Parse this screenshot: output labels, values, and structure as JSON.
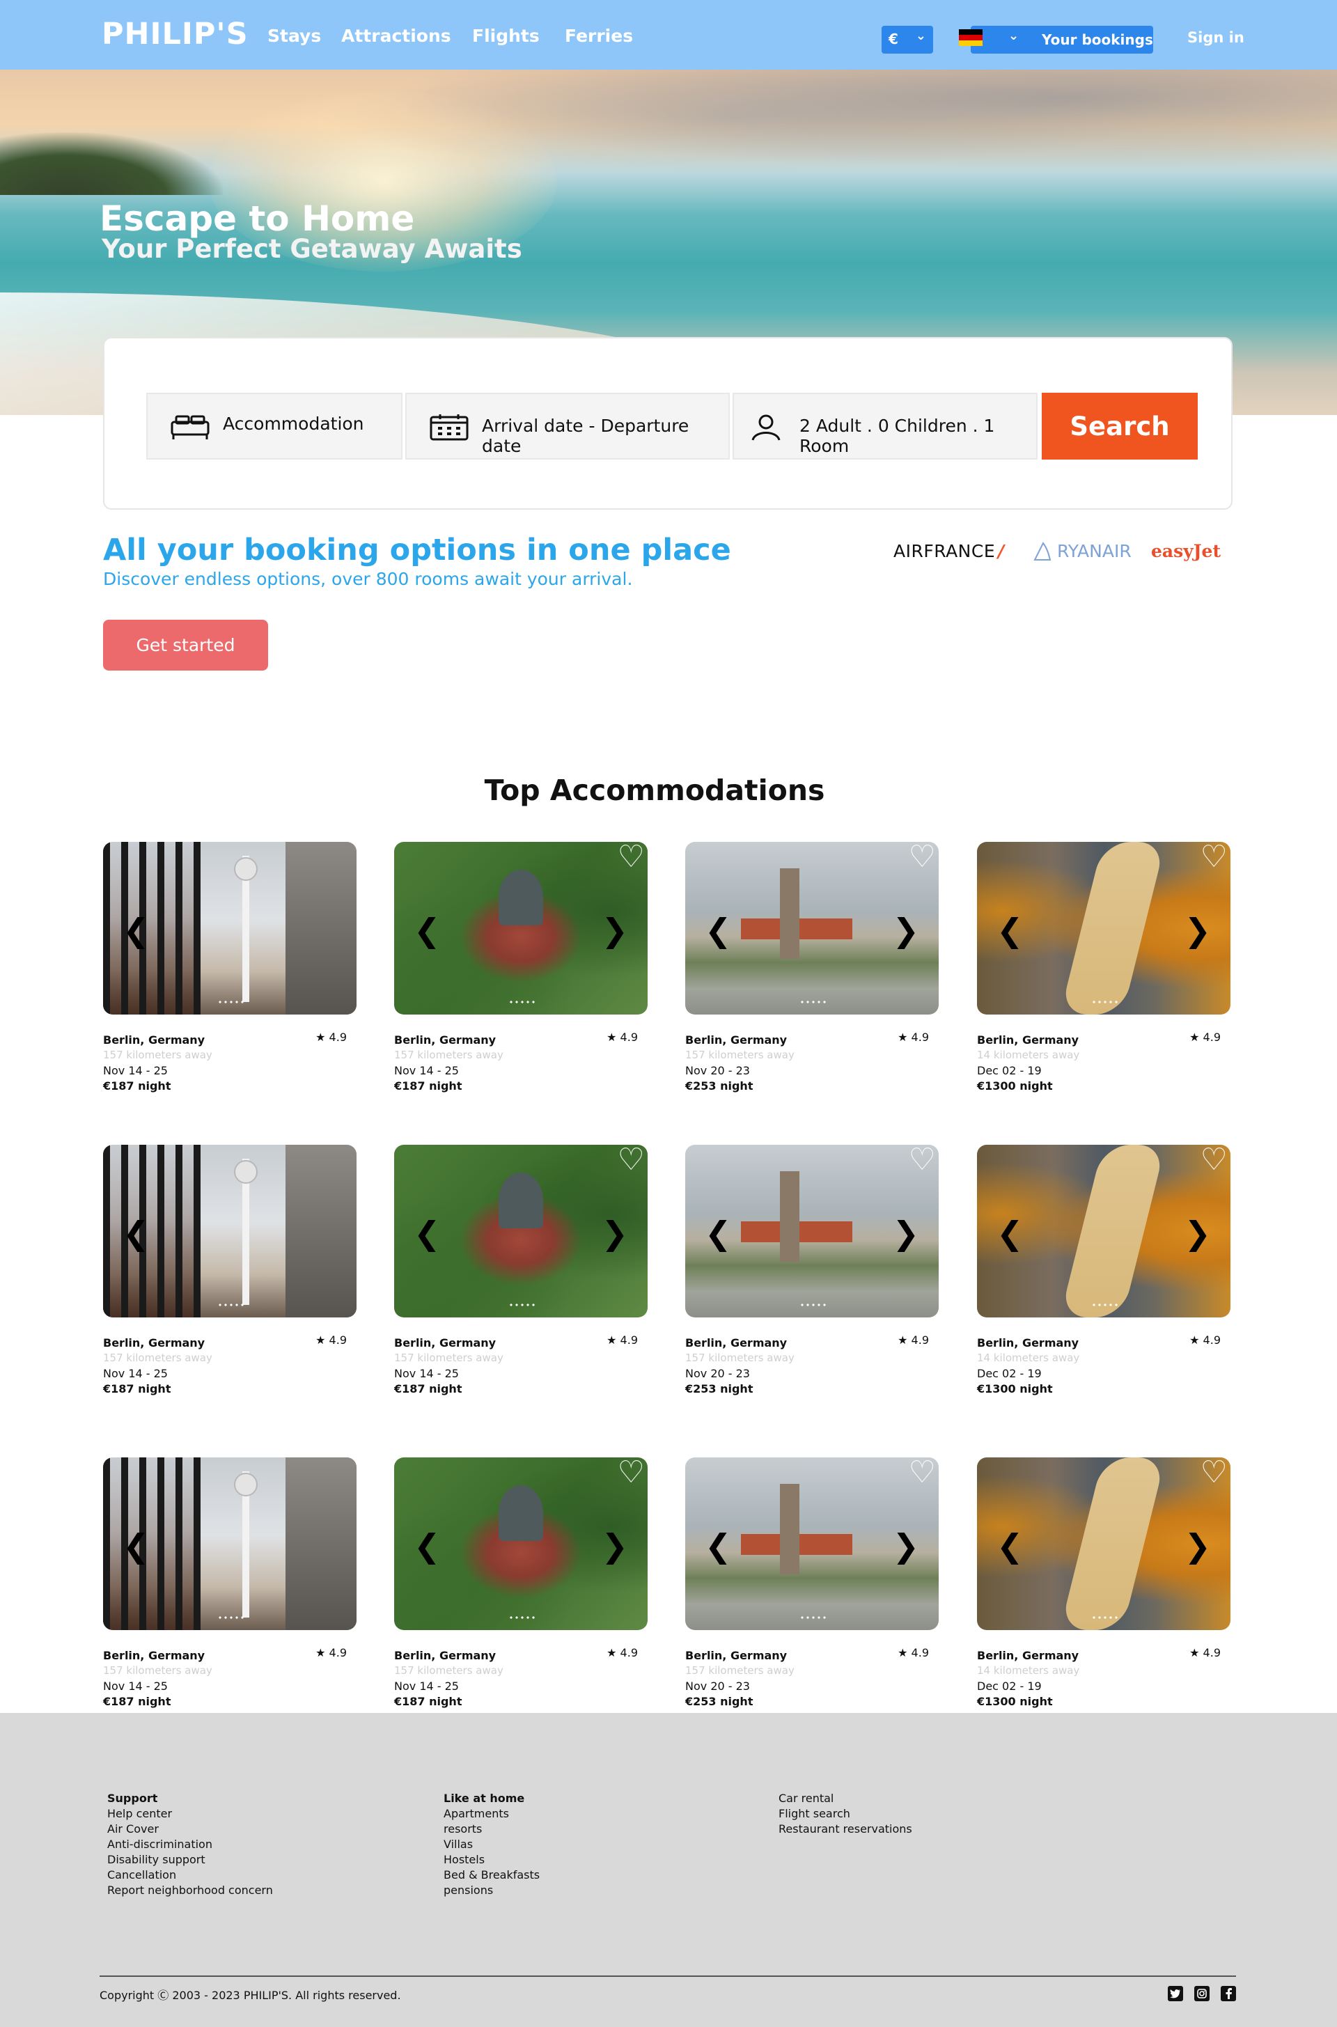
{
  "header": {
    "logo": "PHILIP'S",
    "nav": [
      "Stays",
      "Attractions",
      "Flights",
      "Ferries"
    ],
    "currency": "€",
    "bookings_label": "Your bookings",
    "signin_label": "Sign in",
    "chevron": "⌄"
  },
  "hero": {
    "title": "Escape to Home",
    "subtitle": "Your Perfect Getaway Awaits"
  },
  "search": {
    "accommodation": "Accommodation",
    "dates": "Arrival date - Departure date",
    "guests": "2 Adult . 0 Children . 1 Room",
    "button": "Search"
  },
  "promo": {
    "title": "All your booking options in one place",
    "subtitle": "Discover endless options, over 800 rooms await your arrival.",
    "cta": "Get started",
    "partners": [
      "AIRFRANCE",
      "RYANAIR",
      "easyJet"
    ]
  },
  "section_title": "Top Accommodations",
  "icons": {
    "heart": "♡",
    "arrow_left": "❮",
    "arrow_right": "❯",
    "star": "★"
  },
  "cards": [
    {
      "location": "Berlin, Germany",
      "rating": "4.9",
      "distance": "157 kilometers away",
      "dates": "Nov 14 - 25",
      "price": "€187 night"
    },
    {
      "location": "Berlin, Germany",
      "rating": "4.9",
      "distance": "157 kilometers away",
      "dates": "Nov 14 - 25",
      "price": "€187 night"
    },
    {
      "location": "Berlin, Germany",
      "rating": "4.9",
      "distance": "157 kilometers away",
      "dates": "Nov 20 - 23",
      "price": "€253 night"
    },
    {
      "location": "Berlin, Germany",
      "rating": "4.9",
      "distance": "14 kilometers away",
      "dates": "Dec 02 - 19",
      "price": "€1300 night"
    },
    {
      "location": "Berlin, Germany",
      "rating": "4.9",
      "distance": "157 kilometers away",
      "dates": "Nov 14 - 25",
      "price": "€187 night"
    },
    {
      "location": "Berlin, Germany",
      "rating": "4.9",
      "distance": "157 kilometers away",
      "dates": "Nov 14 - 25",
      "price": "€187 night"
    },
    {
      "location": "Berlin, Germany",
      "rating": "4.9",
      "distance": "157 kilometers away",
      "dates": "Nov 20 - 23",
      "price": "€253 night"
    },
    {
      "location": "Berlin, Germany",
      "rating": "4.9",
      "distance": "14 kilometers away",
      "dates": "Dec 02 - 19",
      "price": "€1300 night"
    },
    {
      "location": "Berlin, Germany",
      "rating": "4.9",
      "distance": "157 kilometers away",
      "dates": "Nov 14 - 25",
      "price": "€187 night"
    },
    {
      "location": "Berlin, Germany",
      "rating": "4.9",
      "distance": "157 kilometers away",
      "dates": "Nov 14 - 25",
      "price": "€187 night"
    },
    {
      "location": "Berlin, Germany",
      "rating": "4.9",
      "distance": "157 kilometers away",
      "dates": "Nov 20 - 23",
      "price": "€253 night"
    },
    {
      "location": "Berlin, Germany",
      "rating": "4.9",
      "distance": "14 kilometers away",
      "dates": "Dec 02 - 19",
      "price": "€1300 night"
    }
  ],
  "footer": {
    "col1": {
      "heading": "Support",
      "links": [
        "Help center",
        "Air Cover",
        "Anti-discrimination",
        "Disability support",
        "Cancellation",
        "Report neighborhood concern"
      ]
    },
    "col2": {
      "heading": "Like at home",
      "links": [
        "Apartments",
        "resorts",
        "Villas",
        "Hostels",
        "Bed & Breakfasts",
        "pensions"
      ]
    },
    "col3": {
      "links": [
        "Car rental",
        "Flight search",
        "Restaurant reservations"
      ]
    },
    "copyright": "Copyright Ⓒ 2003 - 2023 PHILIP'S. All rights reserved.",
    "social": [
      "twitter-icon",
      "instagram-icon",
      "facebook-icon"
    ]
  }
}
